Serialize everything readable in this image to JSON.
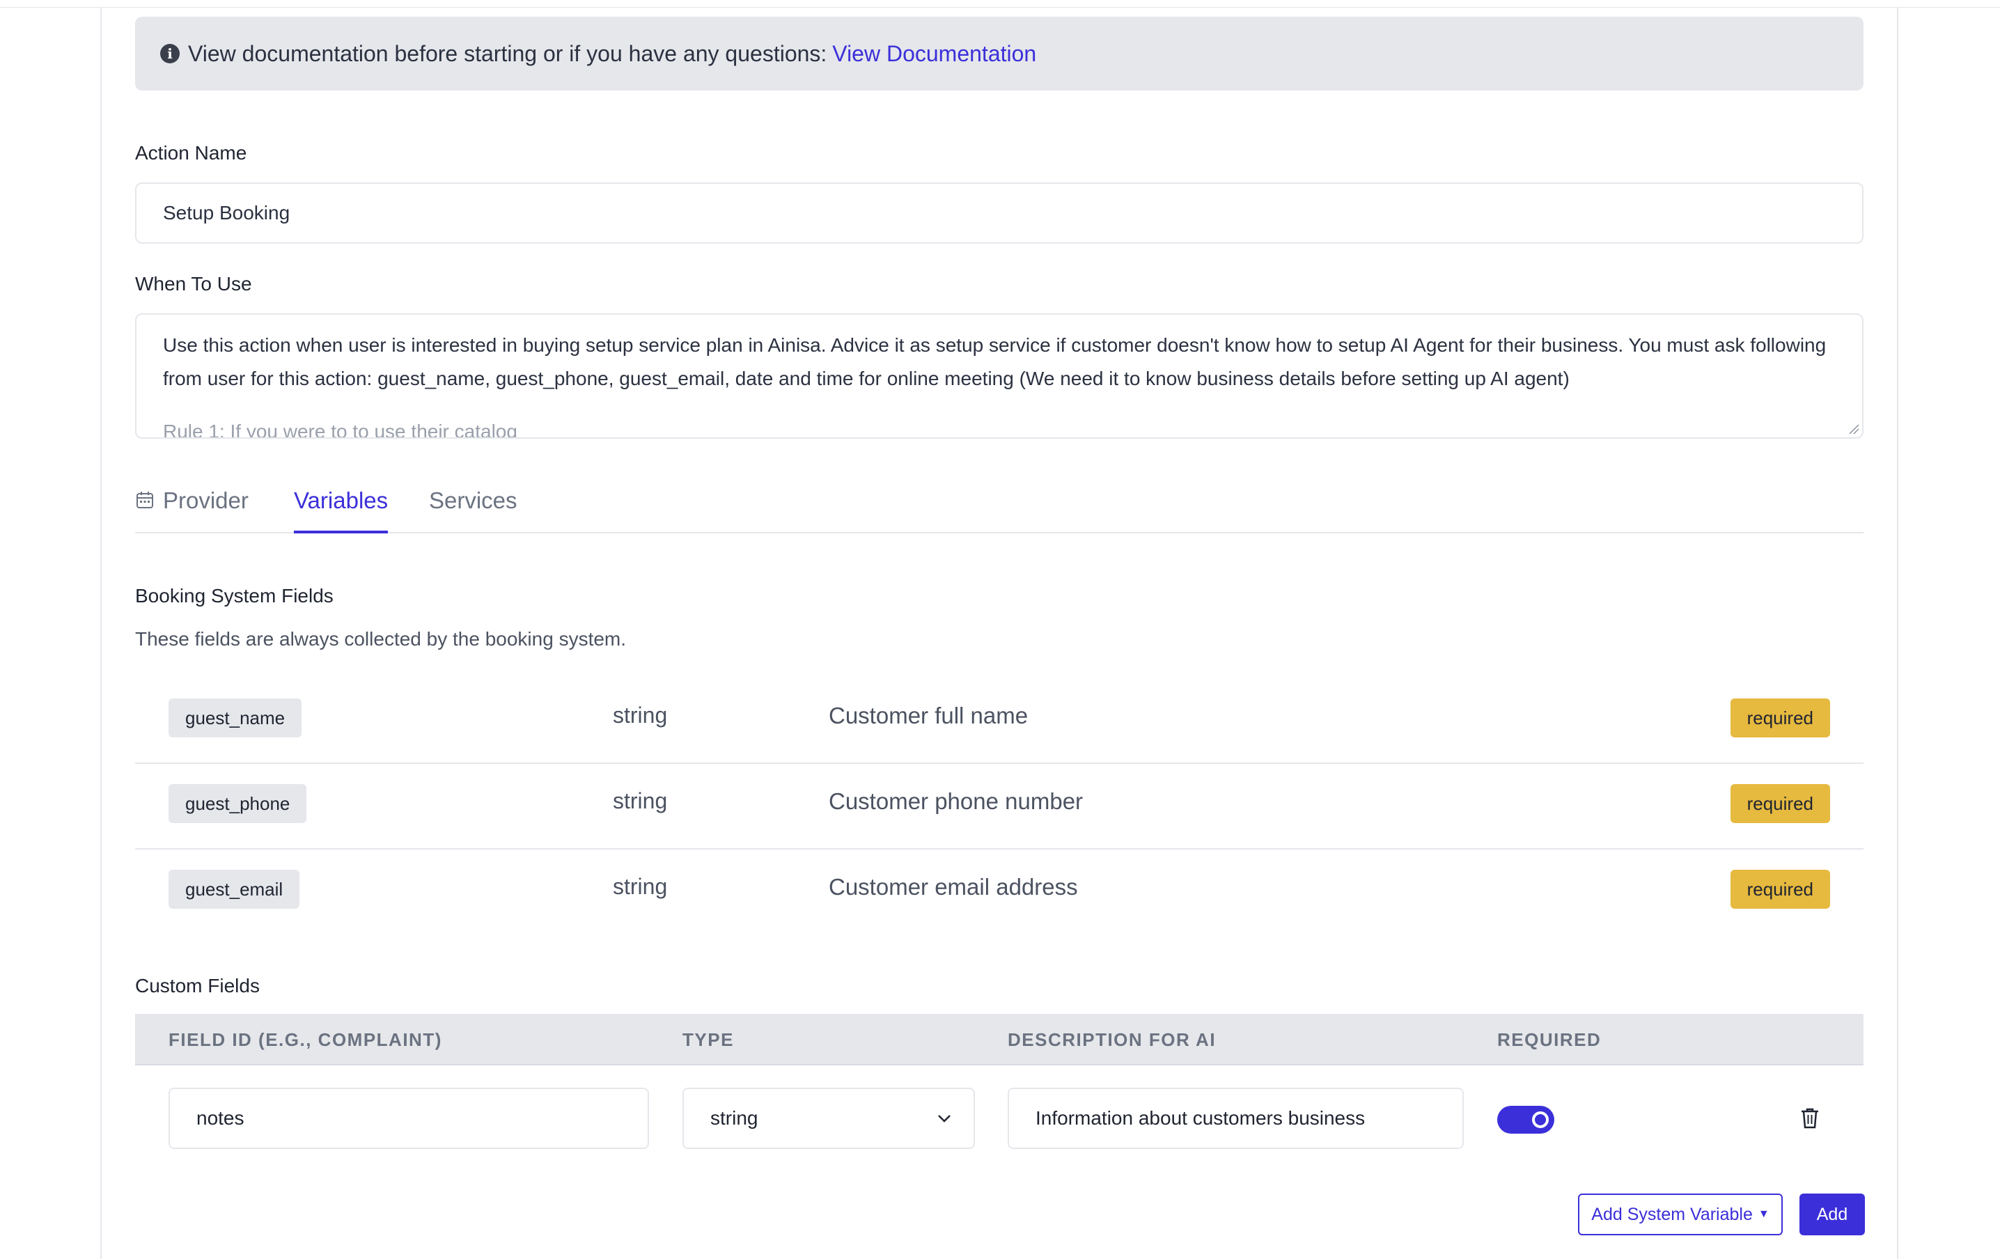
{
  "notice": {
    "text": "View documentation before starting or if you have any questions:",
    "link": "View Documentation"
  },
  "action_name": {
    "label": "Action Name",
    "value": "Setup Booking"
  },
  "when_to_use": {
    "label": "When To Use",
    "value": "Use this action when user is interested in buying setup service plan in Ainisa. Advice it as setup service if customer doesn't know how to setup AI Agent for their business. You must ask following from user for this action: guest_name, guest_phone, guest_email, date and time for online meeting (We need it to know business details before setting up AI agent)",
    "overflow_text": "Rule 1: If you were to to use their catalog"
  },
  "tabs": [
    {
      "label": "Provider",
      "icon": "calendar-icon"
    },
    {
      "label": "Variables",
      "active": true
    },
    {
      "label": "Services"
    }
  ],
  "booking_system": {
    "title": "Booking System Fields",
    "subtitle": "These fields are always collected by the booking system.",
    "fields": [
      {
        "id": "guest_name",
        "type": "string",
        "description": "Customer full name",
        "badge": "required"
      },
      {
        "id": "guest_phone",
        "type": "string",
        "description": "Customer phone number",
        "badge": "required"
      },
      {
        "id": "guest_email",
        "type": "string",
        "description": "Customer email address",
        "badge": "required"
      }
    ]
  },
  "custom_fields": {
    "title": "Custom Fields",
    "headers": {
      "field_id": "FIELD ID (E.G., COMPLAINT)",
      "type": "TYPE",
      "description": "DESCRIPTION FOR AI",
      "required": "REQUIRED"
    },
    "rows": [
      {
        "field_id": "notes",
        "type": "string",
        "description": "Information about customers business",
        "required": true
      }
    ]
  },
  "buttons": {
    "add_system_variable": "Add System Variable",
    "add": "Add"
  },
  "colors": {
    "accent": "#3b2fd9",
    "badge": "#e6b93f",
    "panel": "#e5e7eb"
  }
}
